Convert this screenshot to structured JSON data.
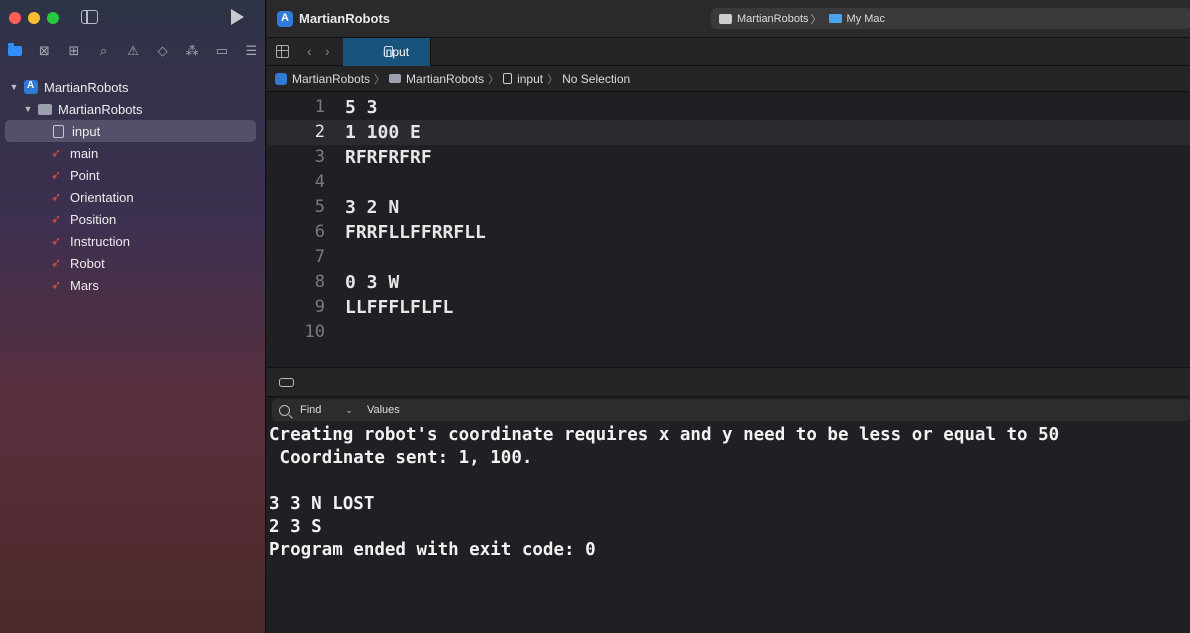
{
  "window": {
    "title": "MartianRobots"
  },
  "scheme": {
    "target": "MartianRobots",
    "destination": "My Mac"
  },
  "navigator": {
    "project": "MartianRobots",
    "group": "MartianRobots",
    "files": [
      {
        "name": "input",
        "type": "plain"
      },
      {
        "name": "main",
        "type": "swift"
      },
      {
        "name": "Point",
        "type": "swift"
      },
      {
        "name": "Orientation",
        "type": "swift"
      },
      {
        "name": "Position",
        "type": "swift"
      },
      {
        "name": "Instruction",
        "type": "swift"
      },
      {
        "name": "Robot",
        "type": "swift"
      },
      {
        "name": "Mars",
        "type": "swift"
      }
    ],
    "selected_index": 0
  },
  "tab": {
    "label": "input"
  },
  "jumpbar": {
    "items": [
      "MartianRobots",
      "MartianRobots",
      "input",
      "No Selection"
    ]
  },
  "editor": {
    "current_line": 2,
    "lines": [
      {
        "num": "1",
        "text": "5 3"
      },
      {
        "num": "2",
        "text": "1 100 E"
      },
      {
        "num": "3",
        "text": "RFRFRFRF"
      },
      {
        "num": "4",
        "text": ""
      },
      {
        "num": "5",
        "text": "3 2 N"
      },
      {
        "num": "6",
        "text": "FRRFLLFFRRFLL"
      },
      {
        "num": "7",
        "text": ""
      },
      {
        "num": "8",
        "text": "0 3 W"
      },
      {
        "num": "9",
        "text": "LLFFFLFLFL"
      },
      {
        "num": "10",
        "text": ""
      }
    ]
  },
  "filter": {
    "find_label": "Find",
    "values_label": "Values"
  },
  "console": {
    "lines": [
      "Creating robot's coordinate requires x and y need to be less or equal to 50",
      " Coordinate sent: 1, 100.",
      "",
      "3 3 N LOST",
      "2 3 S",
      "Program ended with exit code: 0"
    ]
  },
  "colors": {
    "accent": "#2f8ef7",
    "selected_tab": "#17537a",
    "swift": "#f05138"
  }
}
